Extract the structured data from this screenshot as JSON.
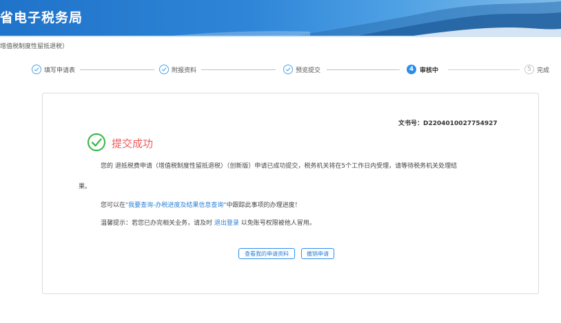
{
  "header": {
    "title": "省电子税务局"
  },
  "breadcrumb": "增值税制度性留抵退税）",
  "steps": [
    {
      "index": "1",
      "label": "填写申请表",
      "status": "done"
    },
    {
      "index": "2",
      "label": "附报资料",
      "status": "done"
    },
    {
      "index": "3",
      "label": "预览提交",
      "status": "done"
    },
    {
      "index": "4",
      "label": "审核中",
      "status": "active"
    },
    {
      "index": "5",
      "label": "完成",
      "status": "todo"
    }
  ],
  "result": {
    "doc_label": "文书号：D2204010027754927",
    "title": "提交成功",
    "message_line1": "您的 退抵税费申请（增值税制度性留抵退税）（创新版）申请已成功提交，税务机关将在5个工作日内受理，请等待税务机关处理结",
    "message_line2": "果。",
    "query_prefix": "您可以在",
    "query_link": "\"我要查询-办税进度及结果信息查询\"",
    "query_suffix": "中跟踪此事项的办理进度！",
    "tip_prefix": "温馨提示：若您已办完相关业务，请及时 ",
    "tip_link": "退出登录",
    "tip_suffix": " 以免账号权限被他人冒用。"
  },
  "buttons": {
    "view_application": "查看我的申请资料",
    "revoke_application": "撤销申请"
  },
  "colors": {
    "accent": "#2a8ef0",
    "success": "#3fb94b",
    "title_red": "#ef5b5b"
  }
}
